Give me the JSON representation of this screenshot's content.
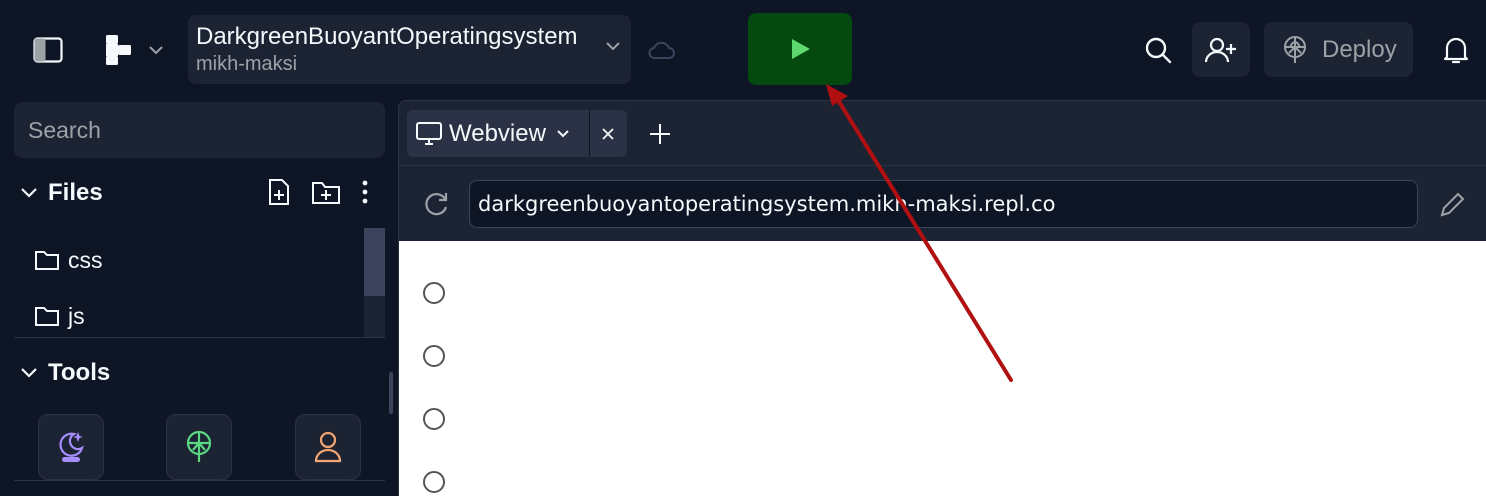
{
  "header": {
    "repl_title": "DarkgreenBuoyantOperatingsystem",
    "repl_owner": "mikh-maksi",
    "deploy_label": "Deploy"
  },
  "sidebar": {
    "search_placeholder": "Search",
    "files_title": "Files",
    "files": [
      {
        "name": "css",
        "icon": "folder-icon"
      },
      {
        "name": "js",
        "icon": "folder-icon"
      }
    ],
    "tools_title": "Tools",
    "tools": [
      {
        "icon": "ai-assistant-icon",
        "color": "#a68eff"
      },
      {
        "icon": "deployments-icon",
        "color": "#5bd881"
      },
      {
        "icon": "user-icon",
        "color": "#f5a672"
      }
    ]
  },
  "main": {
    "tab_label": "Webview",
    "url": "darkgreenbuoyantoperatingsystem.mikh-maksi.repl.co",
    "radio_count": 4
  },
  "colors": {
    "run_button_bg": "#044a10",
    "run_icon": "#5ed96d",
    "annotation_arrow": "#b01010"
  }
}
